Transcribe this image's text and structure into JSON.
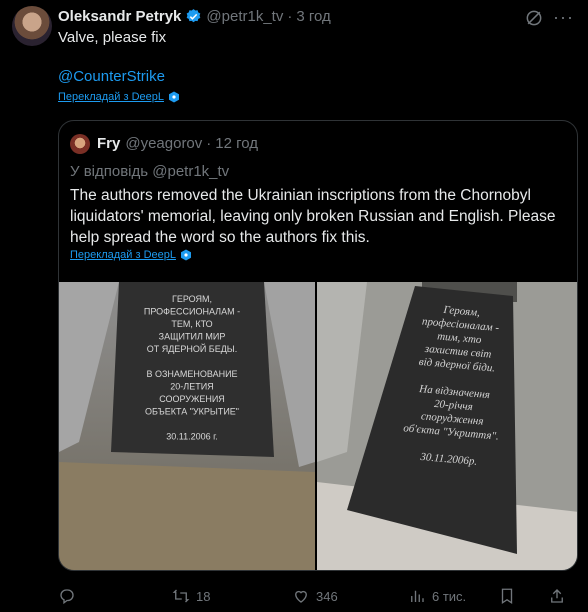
{
  "author": {
    "name": "Oleksandr Petryk",
    "handle": "@petr1k_tv",
    "time": "3 год"
  },
  "tweet": {
    "text": "Valve, please fix",
    "mention": "@CounterStrike",
    "translate_label": "Перекладай з DeepL"
  },
  "quote": {
    "name": "Fry",
    "handle": "@yeagorov",
    "time": "12 год",
    "reply_to": "У відповідь @petr1k_tv",
    "text": "The authors removed the Ukrainian inscriptions from the Chornobyl liquidators' memorial, leaving only broken Russian and English. Please help spread the word so the authors fix this.",
    "translate_label": "Перекладай з DeepL",
    "images": [
      {
        "lines": [
          "ГЕРОЯМ,",
          "ПРОФЕССИОНАЛАМ -",
          "ТЕМ, КТО",
          "ЗАЩИТИЛ МИР",
          "ОТ ЯДЕРНОЙ БЕДЫ.",
          "",
          "В ОЗНАМЕНОВАНИЕ",
          "20-ЛЕТИЯ",
          "СООРУЖЕНИЯ",
          "ОБЪЕКТА \"УКРЫТИЕ\"",
          "",
          "30.11.2006 г."
        ]
      },
      {
        "lines": [
          "Героям,",
          "професіоналам -",
          "тим, хто",
          "захистив світ",
          "від ядерної біди.",
          "",
          "На відзначення",
          "20-річчя",
          "спорудження",
          "об'єкта \"Укриття\".",
          "",
          "30.11.2006р."
        ]
      }
    ]
  },
  "actions": {
    "retweets": "18",
    "likes": "346",
    "views": "6 тис."
  },
  "colors": {
    "accent": "#1d9bf0",
    "muted": "#71767b",
    "background": "#000000",
    "text": "#e7e9ea"
  },
  "icons": [
    "verified-icon",
    "grok-icon",
    "more-icon",
    "deepl-icon",
    "reply-icon",
    "retweet-icon",
    "like-icon",
    "views-icon",
    "bookmark-icon",
    "share-icon"
  ]
}
